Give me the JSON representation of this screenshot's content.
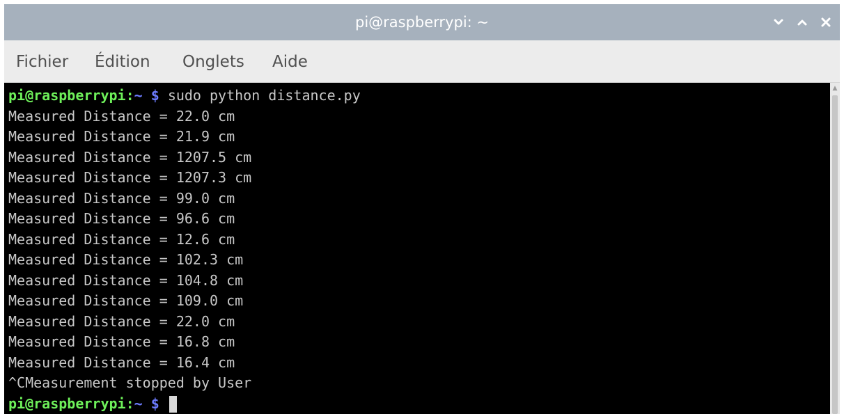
{
  "window": {
    "title": "pi@raspberrypi: ~",
    "titlebar_color": "#a6b1bd",
    "buttons": [
      {
        "name": "minimize-button",
        "icon": "chevron-down-icon"
      },
      {
        "name": "maximize-button",
        "icon": "chevron-up-icon"
      },
      {
        "name": "close-button",
        "icon": "close-icon"
      }
    ]
  },
  "menubar": {
    "items": [
      "Fichier",
      "Édition",
      "Onglets",
      "Aide"
    ]
  },
  "terminal": {
    "background": "#000000",
    "prompt": {
      "user_host": "pi@raspberrypi:",
      "path": "~",
      "symbol": "$"
    },
    "command": "sudo python distance.py",
    "output_lines": [
      "Measured Distance = 22.0 cm",
      "Measured Distance = 21.9 cm",
      "Measured Distance = 1207.5 cm",
      "Measured Distance = 1207.3 cm",
      "Measured Distance = 99.0 cm",
      "Measured Distance = 96.6 cm",
      "Measured Distance = 12.6 cm",
      "Measured Distance = 102.3 cm",
      "Measured Distance = 104.8 cm",
      "Measured Distance = 109.0 cm",
      "Measured Distance = 22.0 cm",
      "Measured Distance = 16.8 cm",
      "Measured Distance = 16.4 cm",
      "^CMeasurement stopped by User"
    ],
    "colors": {
      "user_host": "#6ef05a",
      "path": "#6d7cff",
      "text": "#c8c8c8"
    }
  }
}
